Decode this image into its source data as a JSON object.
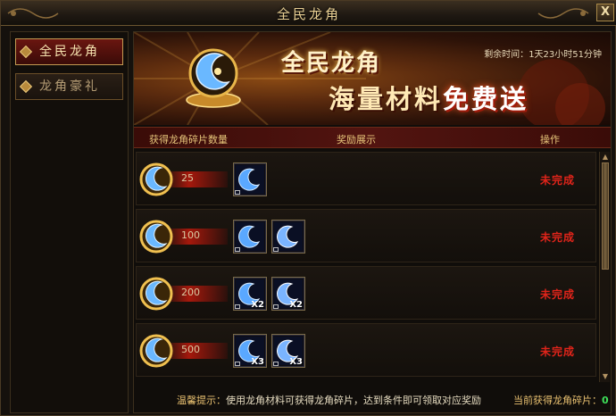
{
  "window": {
    "title": "全民龙角",
    "close_label": "X"
  },
  "sidebar": {
    "tabs": [
      {
        "label": "全民龙角",
        "active": true
      },
      {
        "label": "龙角豪礼",
        "active": false
      }
    ]
  },
  "banner": {
    "title_line1": "全民龙角",
    "title_line2_plain": "海量材料",
    "title_line2_hot": "免费送",
    "timer_label": "剩余时间：",
    "timer_value": "1天23小时51分钟"
  },
  "table": {
    "headers": {
      "count": "获得龙角碎片数量",
      "reward": "奖励展示",
      "action": "操作"
    },
    "rows": [
      {
        "count": "25",
        "items": [
          {
            "qty": ""
          }
        ],
        "status": "未完成"
      },
      {
        "count": "100",
        "items": [
          {
            "qty": ""
          },
          {
            "qty": ""
          }
        ],
        "status": "未完成"
      },
      {
        "count": "200",
        "items": [
          {
            "qty": "X2"
          },
          {
            "qty": "X2"
          }
        ],
        "status": "未完成"
      },
      {
        "count": "500",
        "items": [
          {
            "qty": "X3"
          },
          {
            "qty": "X3"
          }
        ],
        "status": "未完成"
      }
    ]
  },
  "footer": {
    "tip_label": "温馨提示：",
    "tip_text": "使用龙角材料可获得龙角碎片，达到条件即可领取对应奖励",
    "current_label": "当前获得龙角碎片：",
    "current_value": "0"
  },
  "colors": {
    "accent_gold": "#e6c57a",
    "status_red": "#e0241a",
    "count_green": "#3ee05a"
  },
  "icons": [
    "crescent-horn-icon",
    "reward-item-icon",
    "close-icon",
    "scroll-arrow-icon"
  ]
}
